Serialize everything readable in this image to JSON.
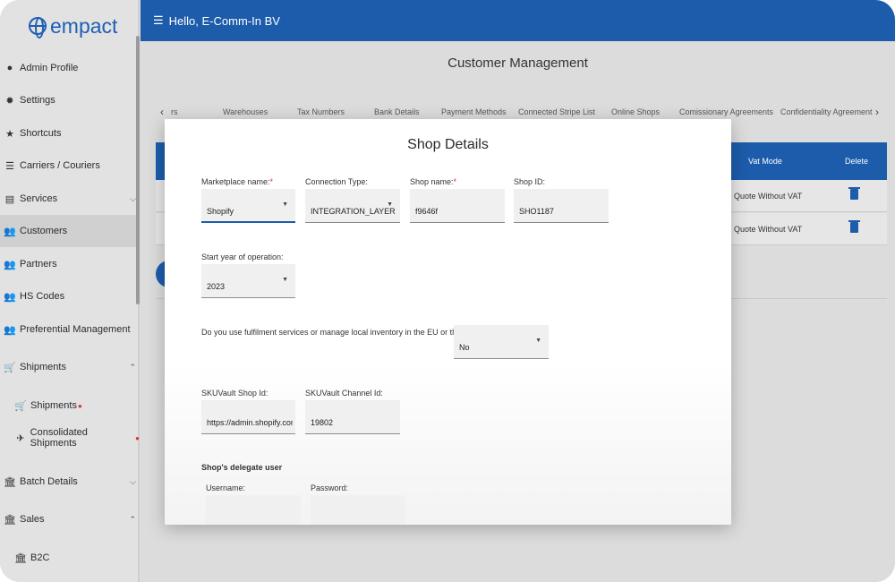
{
  "brand": {
    "name": "empact",
    "color": "#1d5cab"
  },
  "header": {
    "greeting": "Hello, E-Comm-In BV"
  },
  "sidebar": {
    "items": [
      {
        "label": "Admin Profile",
        "icon": "person-circle-icon"
      },
      {
        "label": "Settings",
        "icon": "gear-icon"
      },
      {
        "label": "Shortcuts",
        "icon": "star-icon"
      },
      {
        "label": "Carriers / Couriers",
        "icon": "list-icon"
      },
      {
        "label": "Services",
        "icon": "clipboard-icon"
      },
      {
        "label": "Customers",
        "icon": "people-icon"
      },
      {
        "label": "Partners",
        "icon": "people-icon"
      },
      {
        "label": "HS Codes",
        "icon": "people-icon"
      },
      {
        "label": "Preferential Management",
        "icon": "people-icon"
      },
      {
        "label": "Shipments",
        "icon": "cart-icon"
      },
      {
        "label": "Shipments",
        "icon": "cart-icon"
      },
      {
        "label": "Consolidated Shipments",
        "icon": "airplane-icon"
      },
      {
        "label": "Batch Details",
        "icon": "bank-icon"
      },
      {
        "label": "Sales",
        "icon": "bank-icon"
      },
      {
        "label": "B2C",
        "icon": "bank-icon"
      }
    ]
  },
  "main": {
    "title": "Customer Management",
    "tabs": [
      "rs",
      "Warehouses",
      "Tax Numbers",
      "Bank Details",
      "Payment Methods",
      "Connected Stripe List",
      "Online Shops",
      "Comissionary Agreements",
      "Confidentiality Agreement"
    ],
    "table": {
      "headers": {
        "vat_mode": "Vat Mode",
        "delete": "Delete"
      },
      "rows": [
        {
          "vat_mode": "Quote Without VAT"
        },
        {
          "vat_mode": "Quote Without VAT"
        }
      ]
    }
  },
  "modal": {
    "title": "Shop Details",
    "marketplace": {
      "label": "Marketplace name:",
      "required": "*",
      "value": "Shopify"
    },
    "connection_type": {
      "label": "Connection Type:",
      "value": "INTEGRATION_LAYER"
    },
    "shop_name": {
      "label": "Shop name:",
      "required": "*",
      "value": "f9646f"
    },
    "shop_id": {
      "label": "Shop ID:",
      "value": "SHO1187"
    },
    "start_year": {
      "label": "Start year of operation:",
      "value": "2023"
    },
    "fulfilment": {
      "label": "Do you use fulfilment services or manage local inventory in the EU or the UK?",
      "required": "*",
      "value": "No"
    },
    "skuvault_shop": {
      "label": "SKUVault Shop Id:",
      "value": "https://admin.shopify.com/st"
    },
    "skuvault_channel": {
      "label": "SKUVault Channel Id:",
      "value": "19802"
    },
    "delegate": {
      "section": "Shop's delegate user",
      "username_label": "Username:",
      "password_label": "Password:"
    }
  }
}
